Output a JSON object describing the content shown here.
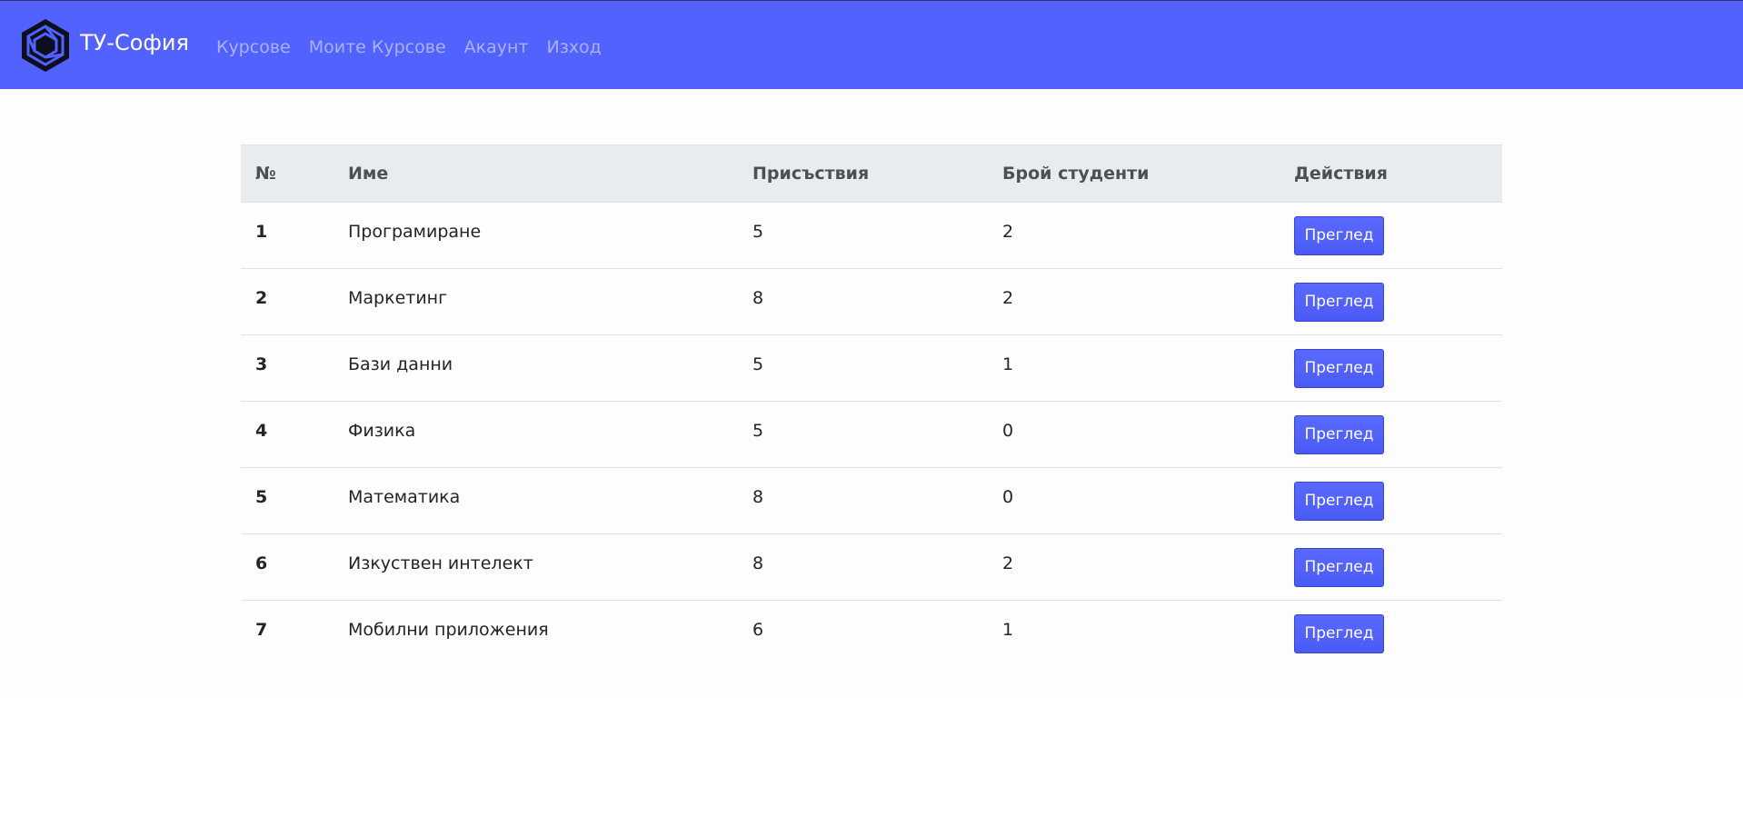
{
  "navbar": {
    "brand": "ТУ-София",
    "links": [
      "Курсове",
      "Моите Курсове",
      "Акаунт",
      "Изход"
    ],
    "color": "#5162ff"
  },
  "table": {
    "headers": [
      "№",
      "Име",
      "Присъствия",
      "Брой студенти",
      "Действия"
    ],
    "rows": [
      {
        "num": "1",
        "name": "Програмиране",
        "attendance": "5",
        "students": "2",
        "action": "Преглед"
      },
      {
        "num": "2",
        "name": "Маркетинг",
        "attendance": "8",
        "students": "2",
        "action": "Преглед"
      },
      {
        "num": "3",
        "name": "Бази данни",
        "attendance": "5",
        "students": "1",
        "action": "Преглед"
      },
      {
        "num": "4",
        "name": "Физика",
        "attendance": "5",
        "students": "0",
        "action": "Преглед"
      },
      {
        "num": "5",
        "name": "Математика",
        "attendance": "8",
        "students": "0",
        "action": "Преглед"
      },
      {
        "num": "6",
        "name": "Изкуствен интелект",
        "attendance": "8",
        "students": "2",
        "action": "Преглед"
      },
      {
        "num": "7",
        "name": "Мобилни приложения",
        "attendance": "6",
        "students": "1",
        "action": "Преглед"
      }
    ]
  },
  "icons": {
    "logo": "hexagon-logo-icon"
  },
  "colors": {
    "button": "#5162ff",
    "header_bg": "#e9ecef"
  }
}
